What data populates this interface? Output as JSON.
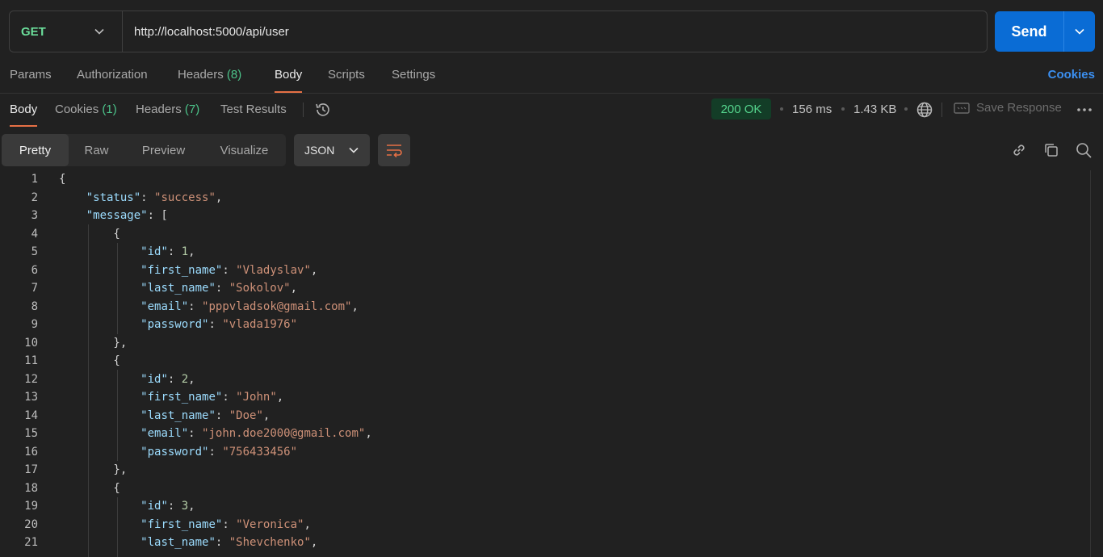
{
  "request": {
    "method": "GET",
    "url": "http://localhost:5000/api/user",
    "send_label": "Send"
  },
  "request_tabs": {
    "params": "Params",
    "authorization": "Authorization",
    "headers": "Headers",
    "headers_count": "(8)",
    "body": "Body",
    "scripts": "Scripts",
    "settings": "Settings",
    "cookies": "Cookies"
  },
  "response_tabs": {
    "body": "Body",
    "cookies": "Cookies",
    "cookies_count": "(1)",
    "headers": "Headers",
    "headers_count": "(7)",
    "test_results": "Test Results"
  },
  "response_meta": {
    "status": "200 OK",
    "time": "156 ms",
    "size": "1.43 KB",
    "save_response": "Save Response"
  },
  "view_modes": {
    "pretty": "Pretty",
    "raw": "Raw",
    "preview": "Preview",
    "visualize": "Visualize",
    "format": "JSON"
  },
  "json_body": {
    "line_numbers": [
      "1",
      "2",
      "3",
      "4",
      "5",
      "6",
      "7",
      "8",
      "9",
      "10",
      "11",
      "12",
      "13",
      "14",
      "15",
      "16",
      "17",
      "18",
      "19",
      "20",
      "21"
    ],
    "keys": {
      "status": "\"status\"",
      "message": "\"message\"",
      "id": "\"id\"",
      "first_name": "\"first_name\"",
      "last_name": "\"last_name\"",
      "email": "\"email\"",
      "password": "\"password\""
    },
    "status_value": "\"success\"",
    "users": [
      {
        "id": "1",
        "first_name": "\"Vladyslav\"",
        "last_name": "\"Sokolov\"",
        "email": "\"pppvladsok@gmail.com\"",
        "password": "\"vlada1976\""
      },
      {
        "id": "2",
        "first_name": "\"John\"",
        "last_name": "\"Doe\"",
        "email": "\"john.doe2000@gmail.com\"",
        "password": "\"756433456\""
      },
      {
        "id": "3",
        "first_name": "\"Veronica\"",
        "last_name": "\"Shevchenko\""
      }
    ]
  }
}
